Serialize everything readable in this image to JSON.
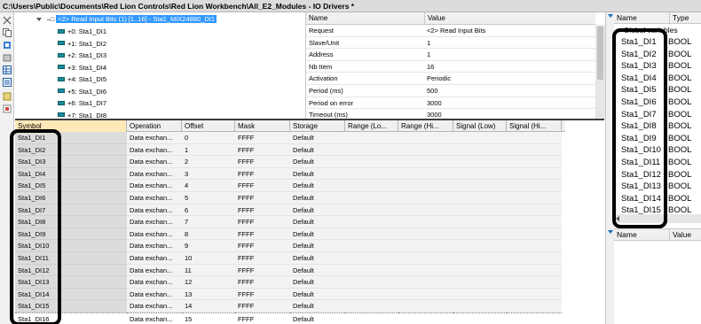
{
  "window": {
    "title": "C:\\Users\\Public\\Documents\\Red Lion Controls\\Red Lion Workbench\\All_E2_Modules - IO Drivers *"
  },
  "tree": {
    "selected_label": "<2> Read Input Bits (1) [1..16] - Sta1_MIX24880_DI1",
    "children": [
      "+0: Sta1_DI1",
      "+1: Sta1_DI2",
      "+2: Sta1_DI3",
      "+3: Sta1_DI4",
      "+4: Sta1_DI5",
      "+5: Sta1_DI6",
      "+6: Sta1_DI7",
      "+7: Sta1_DI8"
    ]
  },
  "properties": {
    "headers": {
      "name": "Name",
      "value": "Value"
    },
    "rows": [
      {
        "name": "Request",
        "value": "<2> Read Input Bits"
      },
      {
        "name": "Slave/Unit",
        "value": "1"
      },
      {
        "name": "Address",
        "value": "1"
      },
      {
        "name": "Nb Item",
        "value": "16"
      },
      {
        "name": "Activation",
        "value": "Periodic"
      },
      {
        "name": "Period (ms)",
        "value": "500"
      },
      {
        "name": "Period on error",
        "value": "3000"
      },
      {
        "name": "Timeout (ms)",
        "value": "3000"
      }
    ]
  },
  "grid": {
    "headers": [
      "Symbol",
      "Operation",
      "Offset",
      "Mask",
      "Storage",
      "Range (Lo...",
      "Range (Hi...",
      "Signal (Low)",
      "Signal (Hi..."
    ],
    "rows": [
      {
        "symbol": "Sta1_DI1",
        "operation": "Data exchan...",
        "offset": "0",
        "mask": "FFFF",
        "storage": "Default"
      },
      {
        "symbol": "Sta1_DI2",
        "operation": "Data exchan...",
        "offset": "1",
        "mask": "FFFF",
        "storage": "Default"
      },
      {
        "symbol": "Sta1_DI3",
        "operation": "Data exchan...",
        "offset": "2",
        "mask": "FFFF",
        "storage": "Default"
      },
      {
        "symbol": "Sta1_DI4",
        "operation": "Data exchan...",
        "offset": "3",
        "mask": "FFFF",
        "storage": "Default"
      },
      {
        "symbol": "Sta1_DI5",
        "operation": "Data exchan...",
        "offset": "4",
        "mask": "FFFF",
        "storage": "Default"
      },
      {
        "symbol": "Sta1_DI6",
        "operation": "Data exchan...",
        "offset": "5",
        "mask": "FFFF",
        "storage": "Default"
      },
      {
        "symbol": "Sta1_DI7",
        "operation": "Data exchan...",
        "offset": "6",
        "mask": "FFFF",
        "storage": "Default"
      },
      {
        "symbol": "Sta1_DI8",
        "operation": "Data exchan...",
        "offset": "7",
        "mask": "FFFF",
        "storage": "Default"
      },
      {
        "symbol": "Sta1_DI9",
        "operation": "Data exchan...",
        "offset": "8",
        "mask": "FFFF",
        "storage": "Default"
      },
      {
        "symbol": "Sta1_DI10",
        "operation": "Data exchan...",
        "offset": "9",
        "mask": "FFFF",
        "storage": "Default"
      },
      {
        "symbol": "Sta1_DI11",
        "operation": "Data exchan...",
        "offset": "10",
        "mask": "FFFF",
        "storage": "Default"
      },
      {
        "symbol": "Sta1_DI12",
        "operation": "Data exchan...",
        "offset": "11",
        "mask": "FFFF",
        "storage": "Default"
      },
      {
        "symbol": "Sta1_DI13",
        "operation": "Data exchan...",
        "offset": "12",
        "mask": "FFFF",
        "storage": "Default"
      },
      {
        "symbol": "Sta1_DI14",
        "operation": "Data exchan...",
        "offset": "13",
        "mask": "FFFF",
        "storage": "Default"
      },
      {
        "symbol": "Sta1_DI15",
        "operation": "Data exchan...",
        "offset": "14",
        "mask": "FFFF",
        "storage": "Default"
      },
      {
        "symbol": "Sta1_DI16",
        "operation": "Data exchan...",
        "offset": "15",
        "mask": "FFFF",
        "storage": "Default"
      }
    ]
  },
  "variables": {
    "headers": {
      "name": "Name",
      "type": "Type"
    },
    "group_label": "Global variables",
    "rows": [
      {
        "name": "Sta1_DI1",
        "type": "BOOL"
      },
      {
        "name": "Sta1_DI2",
        "type": "BOOL"
      },
      {
        "name": "Sta1_DI3",
        "type": "BOOL"
      },
      {
        "name": "Sta1_DI4",
        "type": "BOOL"
      },
      {
        "name": "Sta1_DI5",
        "type": "BOOL"
      },
      {
        "name": "Sta1_DI6",
        "type": "BOOL"
      },
      {
        "name": "Sta1_DI7",
        "type": "BOOL"
      },
      {
        "name": "Sta1_DI8",
        "type": "BOOL"
      },
      {
        "name": "Sta1_DI9",
        "type": "BOOL"
      },
      {
        "name": "Sta1_DI10",
        "type": "BOOL"
      },
      {
        "name": "Sta1_DI11",
        "type": "BOOL"
      },
      {
        "name": "Sta1_DI12",
        "type": "BOOL"
      },
      {
        "name": "Sta1_DI13",
        "type": "BOOL"
      },
      {
        "name": "Sta1_DI14",
        "type": "BOOL"
      },
      {
        "name": "Sta1_DI15",
        "type": "BOOL"
      }
    ]
  },
  "properties2": {
    "headers": {
      "name": "Name",
      "value": "Value"
    }
  },
  "colors": {
    "selection": "#3399ff",
    "node_icon": "#1a8a9a",
    "header_highlight": "#ffe9b8",
    "annotation": "#000000",
    "splitter_arrow": "#1b6fbf"
  }
}
